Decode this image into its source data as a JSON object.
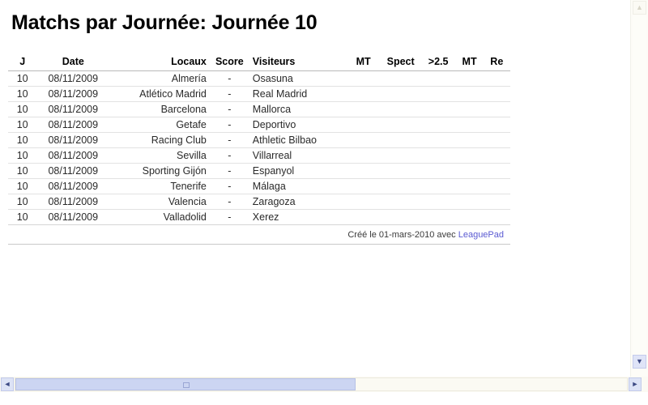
{
  "document": {
    "title": "Matchs par Journée: Journée 10"
  },
  "table": {
    "headers": {
      "j": "J",
      "date": "Date",
      "locaux": "Locaux",
      "score": "Score",
      "visiteurs": "Visiteurs",
      "mt1": "MT",
      "spect": "Spect",
      "over25": ">2.5",
      "mt2": "MT",
      "re": "Re"
    },
    "rows": [
      {
        "j": "10",
        "date": "08/11/2009",
        "locaux": "Almería",
        "score": "-",
        "visiteurs": "Osasuna",
        "mt1": "",
        "spect": "",
        "over25": "",
        "mt2": "",
        "re": ""
      },
      {
        "j": "10",
        "date": "08/11/2009",
        "locaux": "Atlético Madrid",
        "score": "-",
        "visiteurs": "Real Madrid",
        "mt1": "",
        "spect": "",
        "over25": "",
        "mt2": "",
        "re": ""
      },
      {
        "j": "10",
        "date": "08/11/2009",
        "locaux": "Barcelona",
        "score": "-",
        "visiteurs": "Mallorca",
        "mt1": "",
        "spect": "",
        "over25": "",
        "mt2": "",
        "re": ""
      },
      {
        "j": "10",
        "date": "08/11/2009",
        "locaux": "Getafe",
        "score": "-",
        "visiteurs": "Deportivo",
        "mt1": "",
        "spect": "",
        "over25": "",
        "mt2": "",
        "re": ""
      },
      {
        "j": "10",
        "date": "08/11/2009",
        "locaux": "Racing Club",
        "score": "-",
        "visiteurs": "Athletic Bilbao",
        "mt1": "",
        "spect": "",
        "over25": "",
        "mt2": "",
        "re": ""
      },
      {
        "j": "10",
        "date": "08/11/2009",
        "locaux": "Sevilla",
        "score": "-",
        "visiteurs": "Villarreal",
        "mt1": "",
        "spect": "",
        "over25": "",
        "mt2": "",
        "re": ""
      },
      {
        "j": "10",
        "date": "08/11/2009",
        "locaux": "Sporting Gijón",
        "score": "-",
        "visiteurs": "Espanyol",
        "mt1": "",
        "spect": "",
        "over25": "",
        "mt2": "",
        "re": ""
      },
      {
        "j": "10",
        "date": "08/11/2009",
        "locaux": "Tenerife",
        "score": "-",
        "visiteurs": "Málaga",
        "mt1": "",
        "spect": "",
        "over25": "",
        "mt2": "",
        "re": ""
      },
      {
        "j": "10",
        "date": "08/11/2009",
        "locaux": "Valencia",
        "score": "-",
        "visiteurs": "Zaragoza",
        "mt1": "",
        "spect": "",
        "over25": "",
        "mt2": "",
        "re": ""
      },
      {
        "j": "10",
        "date": "08/11/2009",
        "locaux": "Valladolid",
        "score": "-",
        "visiteurs": "Xerez",
        "mt1": "",
        "spect": "",
        "over25": "",
        "mt2": "",
        "re": ""
      }
    ]
  },
  "footer": {
    "credit_prefix": "Créé le 01-mars-2010 avec",
    "credit_link_label": "LeaguePad",
    "link_color": "#5a5ad2"
  },
  "scrollbars": {
    "up_arrow": "▲",
    "down_arrow": "▼",
    "left_arrow": "◄",
    "right_arrow": "►"
  }
}
